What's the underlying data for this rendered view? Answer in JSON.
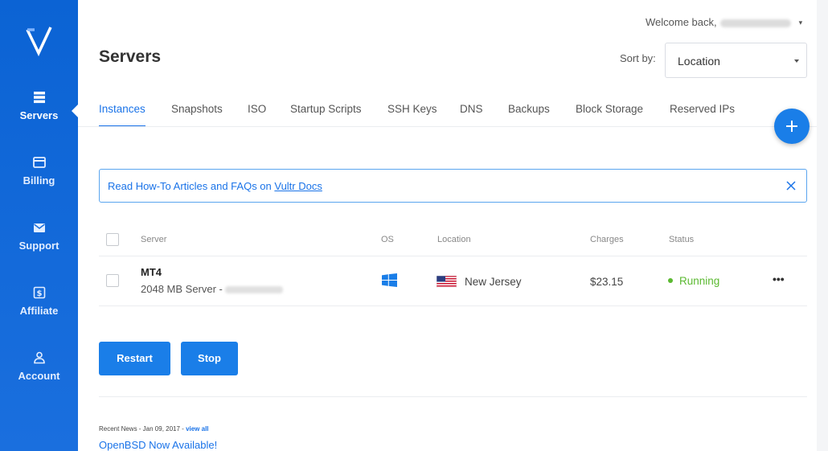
{
  "sidebar": {
    "logo": "vultr-v-logo",
    "items": [
      {
        "label": "Servers",
        "icon": "servers-icon",
        "active": true
      },
      {
        "label": "Billing",
        "icon": "credit-card-icon",
        "active": false
      },
      {
        "label": "Support",
        "icon": "envelope-icon",
        "active": false
      },
      {
        "label": "Affiliate",
        "icon": "dollar-icon",
        "active": false
      },
      {
        "label": "Account",
        "icon": "user-icon",
        "active": false
      }
    ]
  },
  "header": {
    "welcome": "Welcome back,",
    "title": "Servers",
    "sort_label": "Sort by:",
    "sort_value": "Location"
  },
  "tabs": [
    {
      "label": "Instances",
      "active": true
    },
    {
      "label": "Snapshots"
    },
    {
      "label": "ISO"
    },
    {
      "label": "Startup Scripts"
    },
    {
      "label": "SSH Keys"
    },
    {
      "label": "DNS"
    },
    {
      "label": "Backups"
    },
    {
      "label": "Block Storage"
    },
    {
      "label": "Reserved IPs"
    }
  ],
  "notice": {
    "text": "Read How-To Articles and FAQs on ",
    "link": "Vultr Docs"
  },
  "table": {
    "headers": [
      "Server",
      "OS",
      "Location",
      "Charges",
      "Status"
    ],
    "rows": [
      {
        "name": "MT4",
        "subtitle": "2048 MB Server -",
        "os": "windows-icon",
        "location": "New Jersey",
        "flag": "us-flag-icon",
        "charges": "$23.15",
        "status": "Running",
        "more": "•••"
      }
    ]
  },
  "actions": {
    "restart": "Restart",
    "stop": "Stop"
  },
  "news": {
    "meta": "Recent News - Jan 09, 2017 - ",
    "view_all": "view all",
    "title": "OpenBSD Now Available!"
  },
  "colors": {
    "sidebar": "#0b63d4",
    "accent": "#1a7ee8",
    "status_running": "#5bb931"
  }
}
